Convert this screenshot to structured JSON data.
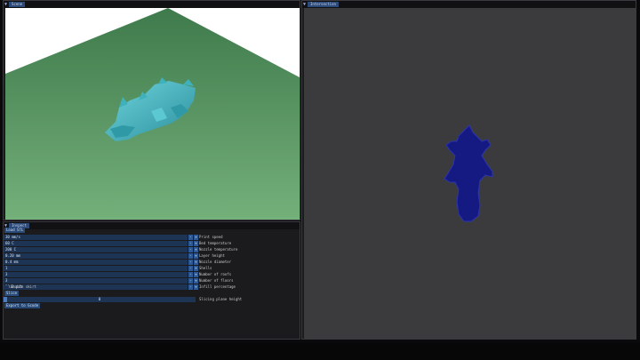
{
  "scene": {
    "title": "Scene"
  },
  "layer_view": {
    "title": "Intersection"
  },
  "inspector": {
    "title": "Inspect",
    "load_button": "Load STL",
    "rows": [
      {
        "value": "30 mm/s",
        "label": "Print speed"
      },
      {
        "value": "60 C",
        "label": "Bed temperature"
      },
      {
        "value": "200 C",
        "label": "Nozzle temperature"
      },
      {
        "value": "0.20 mm",
        "label": "Layer height"
      },
      {
        "value": "0.4 mm",
        "label": "Nozzle diameter"
      },
      {
        "value": "1",
        "label": "Shells"
      },
      {
        "value": "3",
        "label": "Number of roofs"
      },
      {
        "value": "3",
        "label": "Number of floors"
      },
      {
        "value": "20.0 pct",
        "label": "Infill percentage"
      }
    ],
    "enable_skirt": "Enable skirt",
    "slice_button": "Slice",
    "slider": {
      "value": "0",
      "label": "Slicing plane height"
    },
    "export_button": "Export to Gcode"
  },
  "colors": {
    "floor": "#5c9363",
    "sky": "#ffffff",
    "model": "#3fb1bd",
    "layer_fill": "#141a82",
    "layer_bg": "#3b3b3d"
  }
}
